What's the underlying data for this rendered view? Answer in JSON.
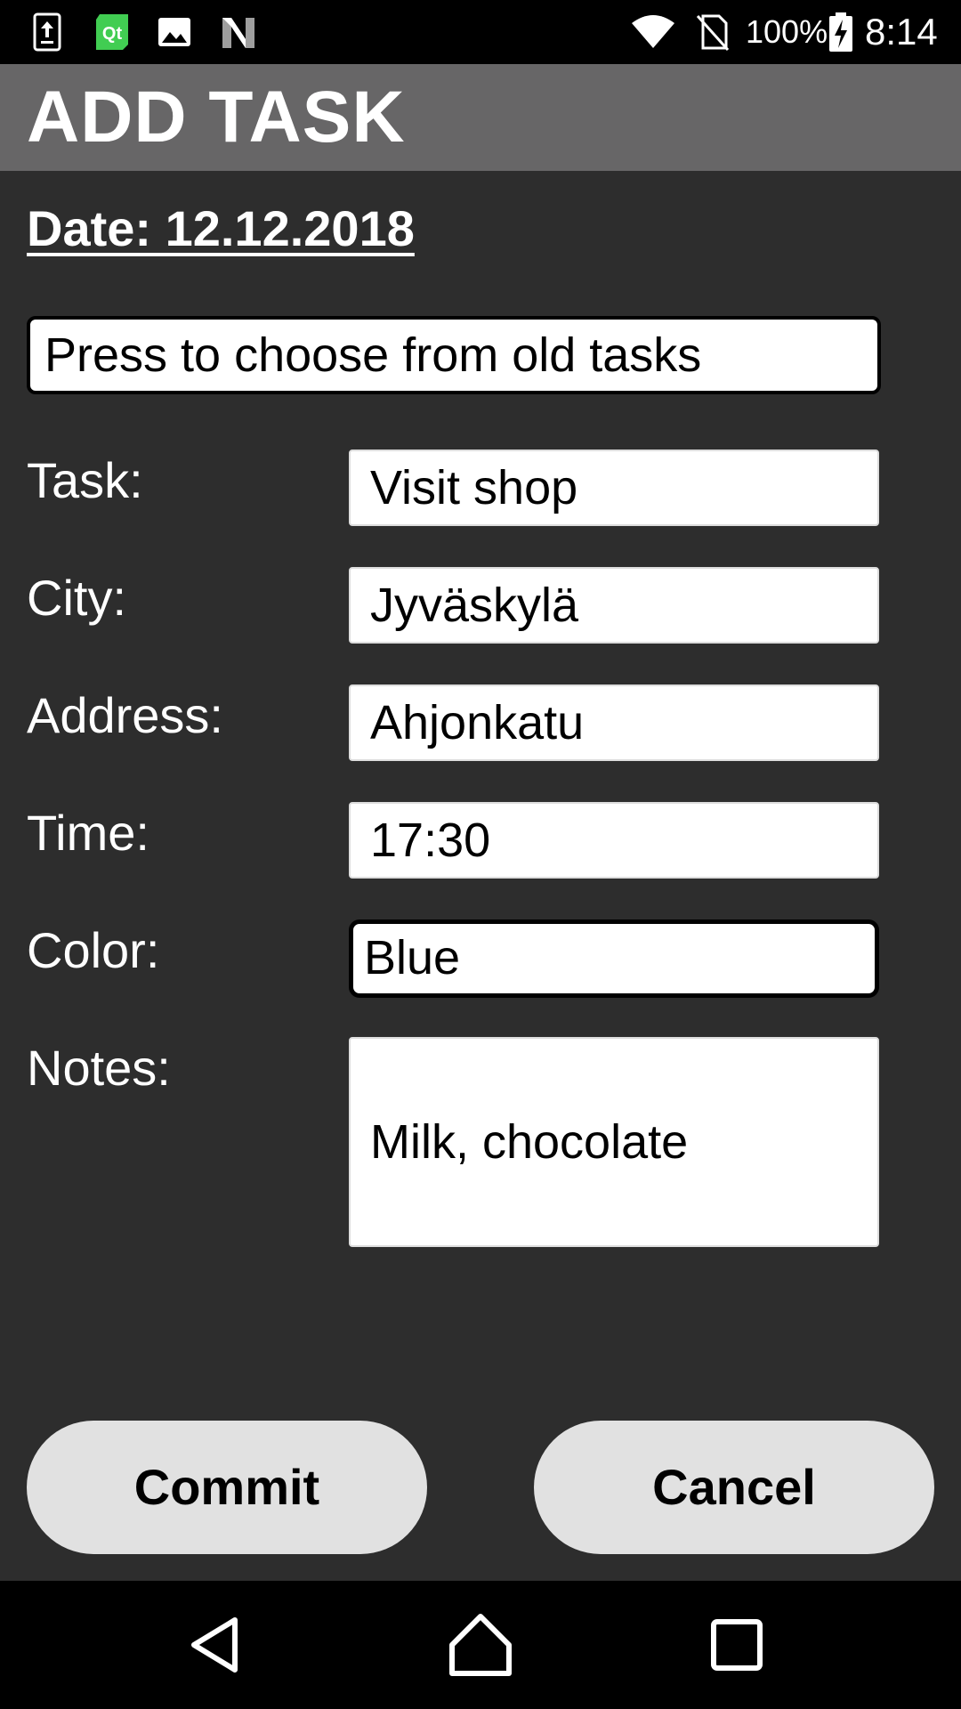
{
  "status_bar": {
    "battery_percent": "100%",
    "time": "8:14",
    "left_icons": [
      "upload-icon",
      "qt-icon",
      "image-icon",
      "n-icon"
    ],
    "right_icons": [
      "wifi-icon",
      "no-sim-icon",
      "battery-charging-icon"
    ]
  },
  "header": {
    "title": "ADD TASK"
  },
  "date_label": "Date: 12.12.2018",
  "old_tasks_button": "Press to choose from old tasks",
  "form": {
    "task": {
      "label": "Task:",
      "value": "Visit shop"
    },
    "city": {
      "label": "City:",
      "value": "Jyväskylä"
    },
    "address": {
      "label": "Address:",
      "value": "Ahjonkatu"
    },
    "time": {
      "label": "Time:",
      "value": "17:30"
    },
    "color": {
      "label": "Color:",
      "value": "Blue"
    },
    "notes": {
      "label": "Notes:",
      "value": "Milk, chocolate"
    }
  },
  "buttons": {
    "commit": "Commit",
    "cancel": "Cancel"
  },
  "nav": [
    "back-icon",
    "home-icon",
    "recents-icon"
  ],
  "colors": {
    "background": "#2d2d2d",
    "header": "#676667",
    "button": "#e1e1e1"
  }
}
